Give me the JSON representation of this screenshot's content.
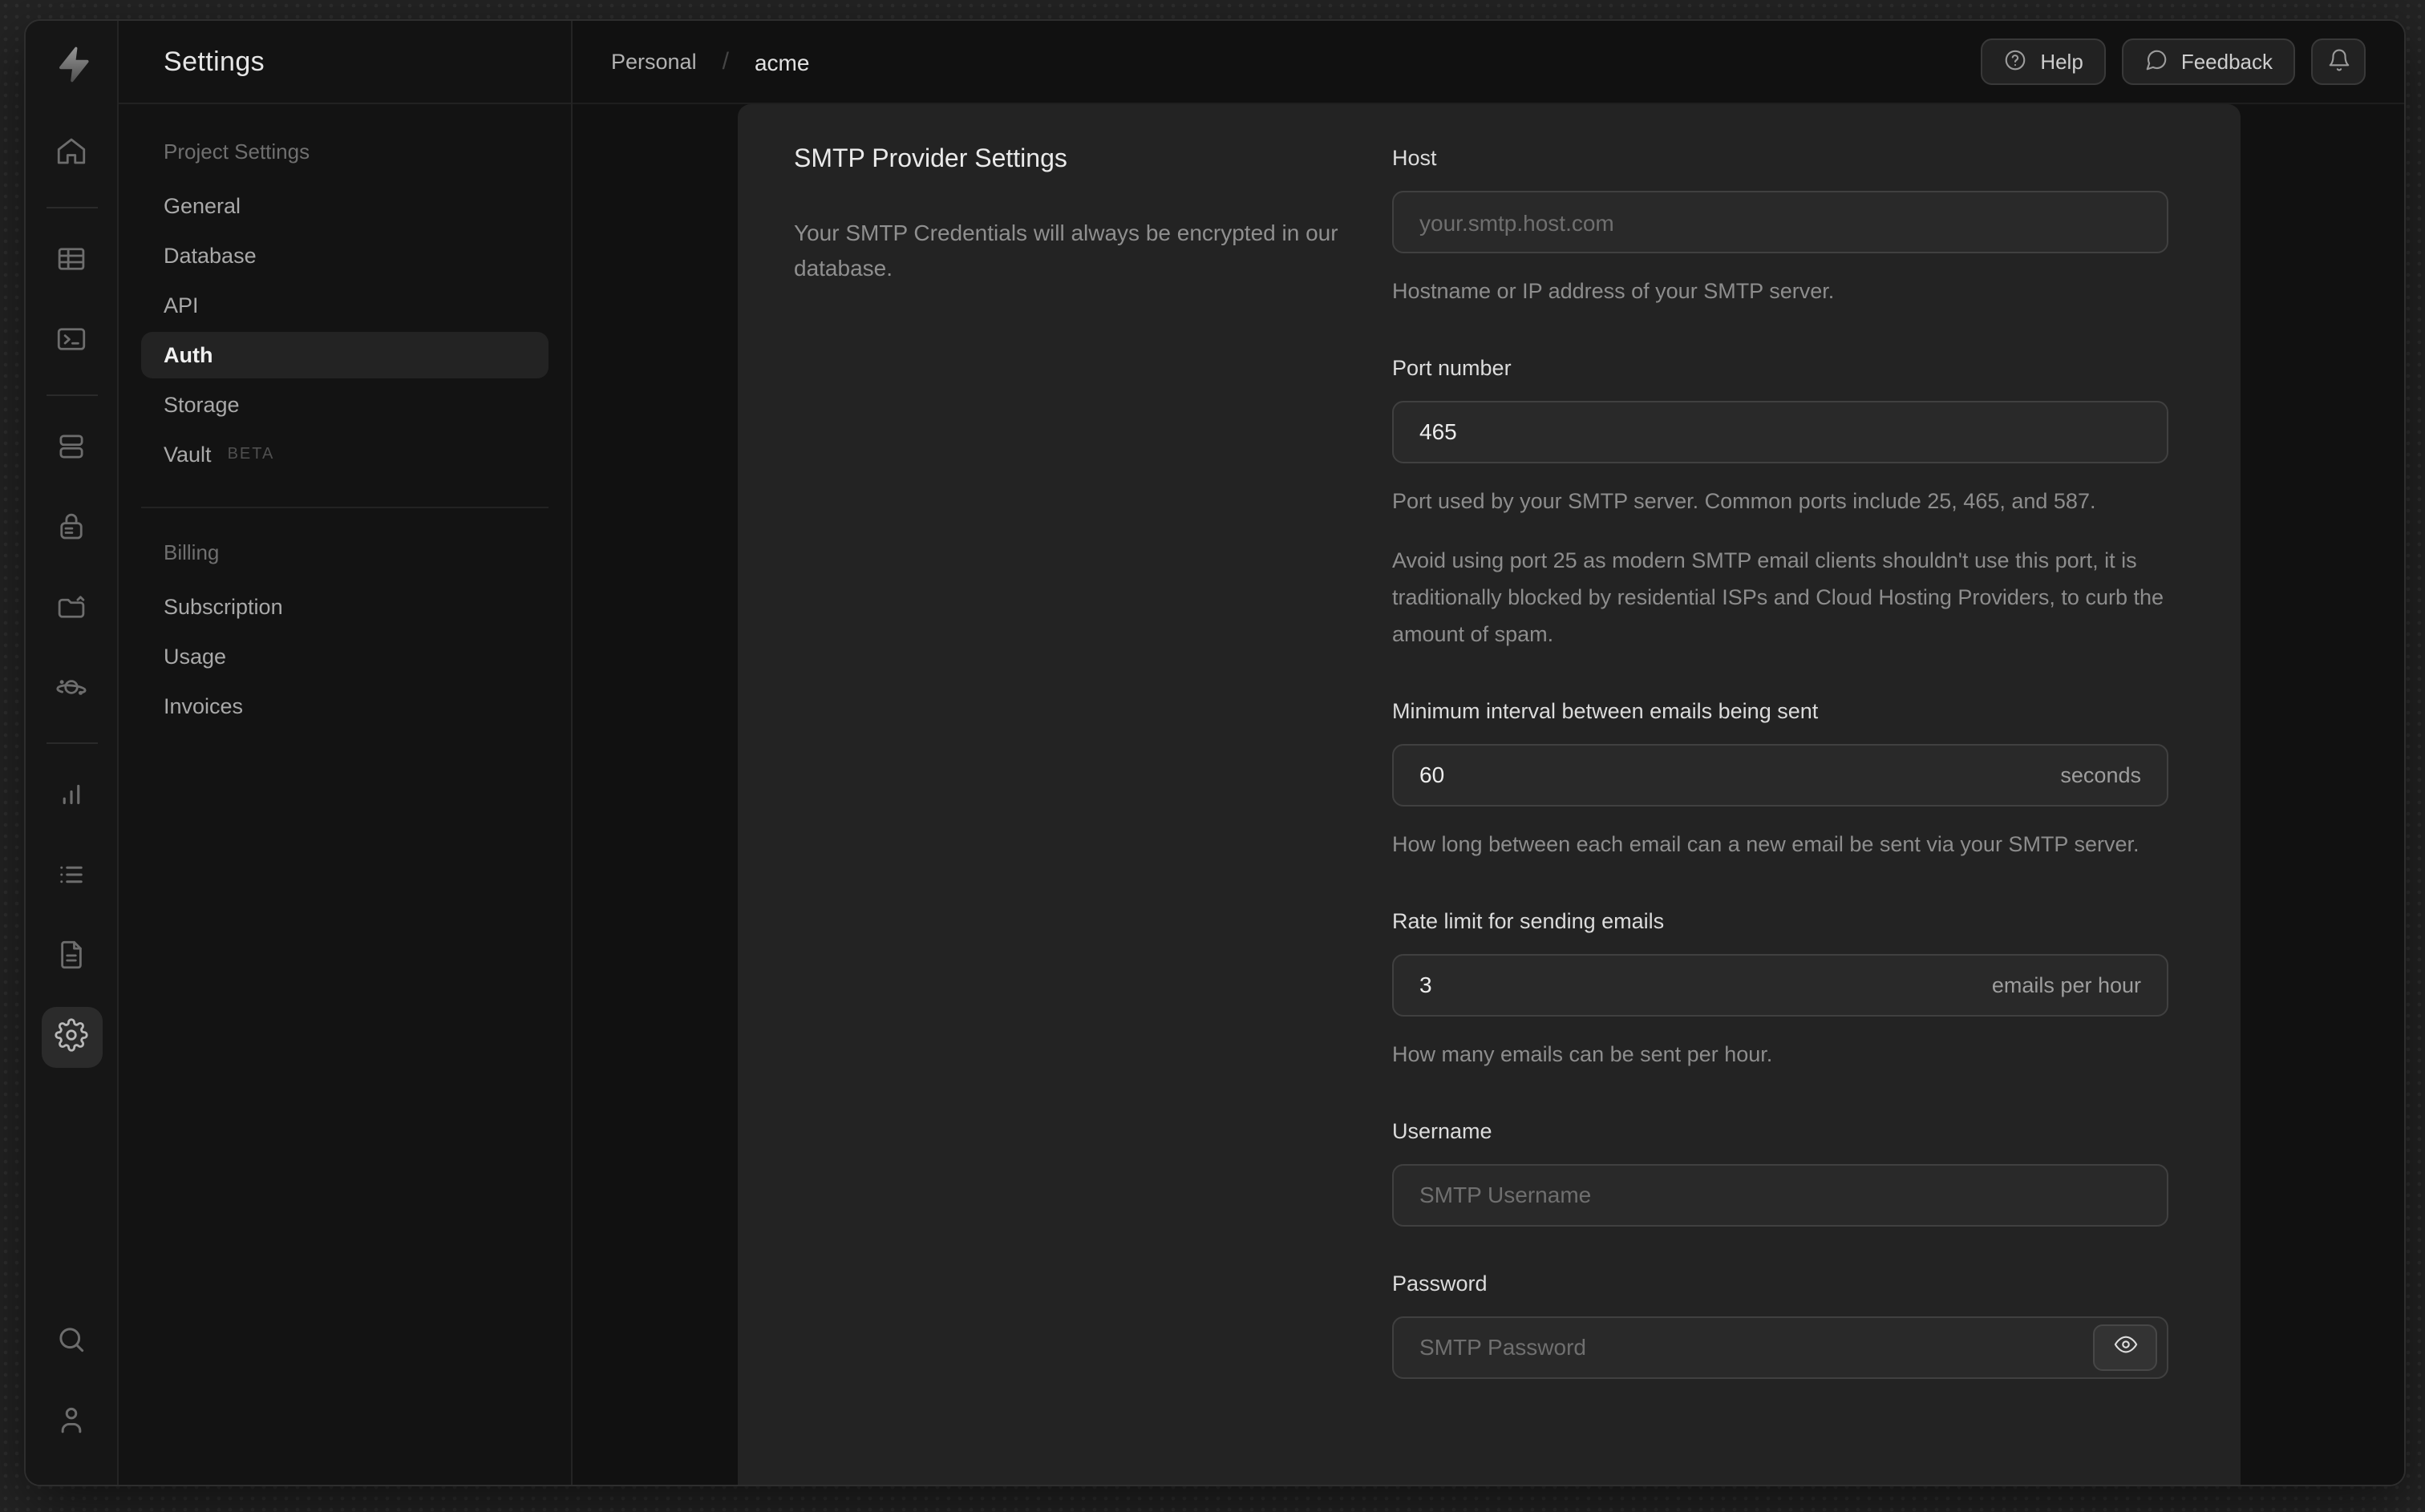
{
  "icon_rail": {
    "active_item": "settings",
    "items": [
      "home",
      "table-editor",
      "sql-editor",
      "database",
      "auth",
      "storage",
      "edge-functions",
      "reports",
      "logs",
      "docs",
      "settings",
      "search",
      "user"
    ]
  },
  "sidebar": {
    "title": "Settings",
    "sections": [
      {
        "heading": "Project Settings",
        "items": [
          {
            "label": "General"
          },
          {
            "label": "Database"
          },
          {
            "label": "API"
          },
          {
            "label": "Auth",
            "active": true
          },
          {
            "label": "Storage"
          },
          {
            "label": "Vault",
            "badge": "BETA"
          }
        ]
      },
      {
        "heading": "Billing",
        "items": [
          {
            "label": "Subscription"
          },
          {
            "label": "Usage"
          },
          {
            "label": "Invoices"
          }
        ]
      }
    ]
  },
  "header": {
    "breadcrumb": {
      "org": "Personal",
      "separator": "/",
      "project": "acme"
    },
    "help_label": "Help",
    "feedback_label": "Feedback",
    "icons": [
      "help-circle",
      "message-circle",
      "bell"
    ]
  },
  "content": {
    "section_title": "SMTP Provider Settings",
    "section_description": "Your SMTP Credentials will always be encrypted in our database.",
    "fields": {
      "host": {
        "label": "Host",
        "placeholder": "your.smtp.host.com",
        "help": "Hostname or IP address of your SMTP server."
      },
      "port": {
        "label": "Port number",
        "value": "465",
        "help": "Port used by your SMTP server. Common ports include 25, 465, and 587.",
        "note": "Avoid using port 25 as modern SMTP email clients shouldn't use this port, it is traditionally blocked by residential ISPs and Cloud Hosting Providers, to curb the amount of spam."
      },
      "min_interval": {
        "label": "Minimum interval between emails being sent",
        "value": "60",
        "unit": "seconds",
        "help": "How long between each email can a new email be sent via your SMTP server."
      },
      "rate_limit": {
        "label": "Rate limit for sending emails",
        "value": "3",
        "unit": "emails per hour",
        "help": "How many emails can be sent per hour."
      },
      "username": {
        "label": "Username",
        "placeholder": "SMTP Username"
      },
      "password": {
        "label": "Password",
        "placeholder": "SMTP Password"
      }
    }
  },
  "colors": {
    "page_bg": "#131313",
    "card_bg": "#232323",
    "input_bg": "#292929",
    "input_border": "#404040",
    "text_primary": "#ededed",
    "text_muted": "#8d8d8d"
  }
}
